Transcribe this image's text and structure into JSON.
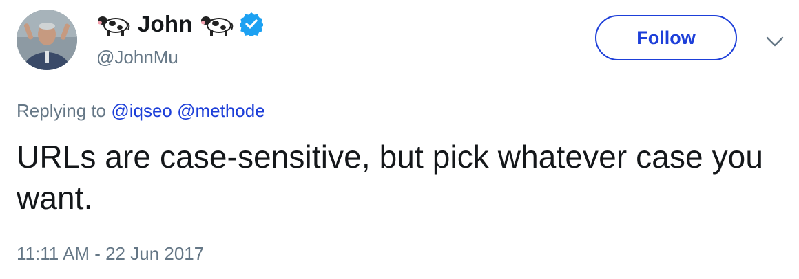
{
  "author": {
    "display_name": "John",
    "handle": "@JohnMu",
    "verified": true,
    "name_emoji": "cow-icon"
  },
  "follow_button": {
    "label": "Follow"
  },
  "reply": {
    "prefix": "Replying to",
    "mentions": [
      "@iqseo",
      "@methode"
    ]
  },
  "tweet": {
    "text": "URLs are case-sensitive, but pick whatever case you want.",
    "timestamp": "11:11 AM - 22 Jun 2017"
  },
  "colors": {
    "link": "#1d3fd9",
    "verified": "#1da1f2",
    "muted": "#657786",
    "text": "#14171a"
  }
}
